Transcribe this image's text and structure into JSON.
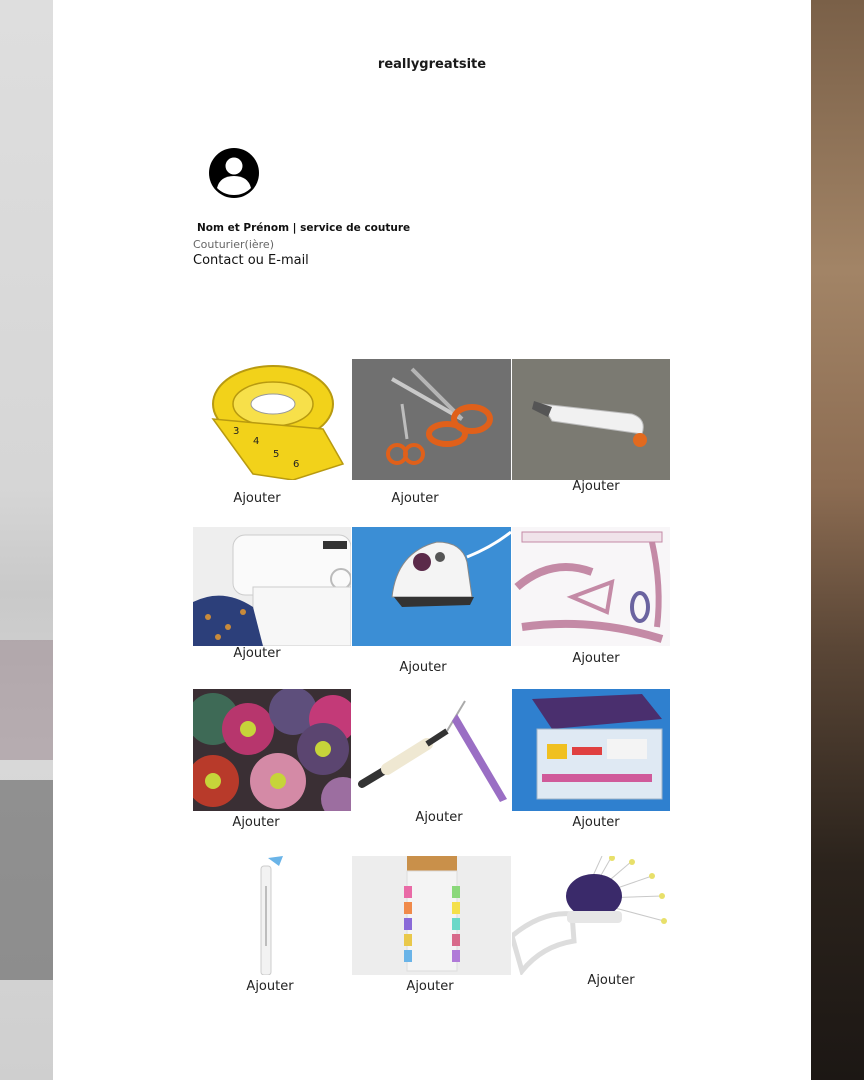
{
  "site": {
    "title": "reallygreatsite"
  },
  "profile": {
    "name": "Nom et Prénom | service de couture",
    "role": "Couturier(ière)",
    "contact": "Contact ou E-mail",
    "avatar_icon": "user-circle-icon"
  },
  "products": [
    {
      "image": "tape-measure",
      "action": "Ajouter"
    },
    {
      "image": "orange-scissors",
      "action": "Ajouter"
    },
    {
      "image": "thread-snips",
      "action": "Ajouter"
    },
    {
      "image": "sewing-machine",
      "action": "Ajouter"
    },
    {
      "image": "mini-iron",
      "action": "Ajouter"
    },
    {
      "image": "pattern-rulers",
      "action": "Ajouter"
    },
    {
      "image": "thread-spools",
      "action": "Ajouter"
    },
    {
      "image": "seam-ripper",
      "action": "Ajouter"
    },
    {
      "image": "sewing-kit-box",
      "action": "Ajouter"
    },
    {
      "image": "fabric-marker",
      "action": "Ajouter"
    },
    {
      "image": "sewing-clips",
      "action": "Ajouter"
    },
    {
      "image": "pin-cushion",
      "action": "Ajouter"
    }
  ]
}
